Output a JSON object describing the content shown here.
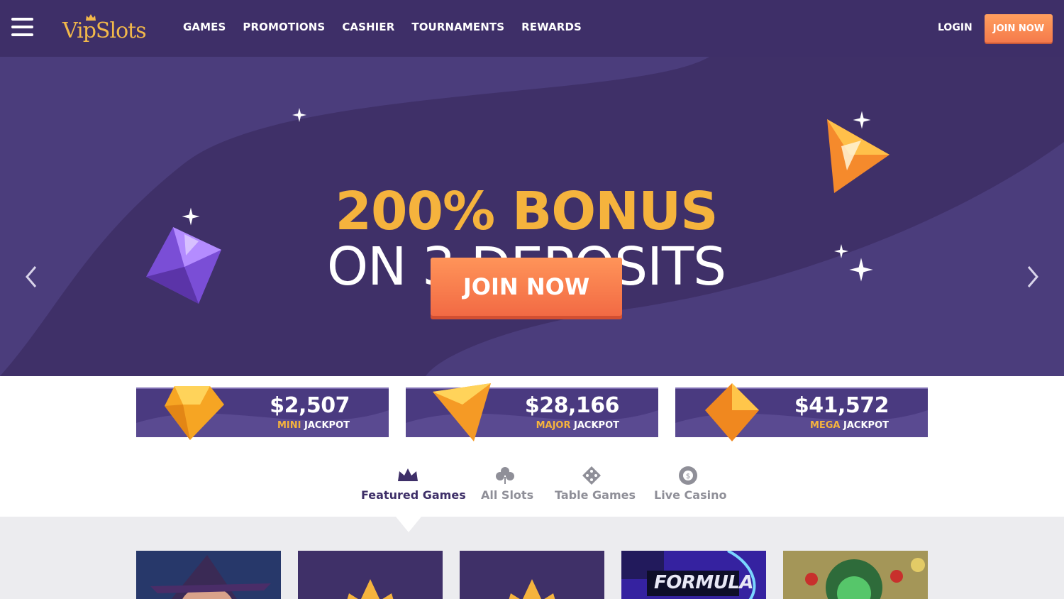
{
  "nav": {
    "brand": "VipSlots",
    "links": [
      "GAMES",
      "PROMOTIONS",
      "CASHIER",
      "TOURNAMENTS",
      "REWARDS"
    ],
    "login": "LOGIN",
    "join": "JOIN NOW",
    "icons": [
      "hamburger-menu-icon",
      "crown-icon"
    ]
  },
  "hero": {
    "title_line1": "200% BONUS",
    "title_line2": "ON 3 DEPOSITS",
    "cta": "JOIN NOW",
    "prev_icon": "chevron-left-icon",
    "next_icon": "chevron-right-icon"
  },
  "jackpots": [
    {
      "amount": "$2,507",
      "tier": "MINI",
      "suffix": "JACKPOT"
    },
    {
      "amount": "$28,166",
      "tier": "MAJOR",
      "suffix": "JACKPOT"
    },
    {
      "amount": "$41,572",
      "tier": "MEGA",
      "suffix": "JACKPOT"
    }
  ],
  "tabs": [
    {
      "label": "Featured Games",
      "icon": "crown-icon",
      "active": true
    },
    {
      "label": "All Slots",
      "icon": "clover-icon",
      "active": false
    },
    {
      "label": "Table Games",
      "icon": "dice-icon",
      "active": false
    },
    {
      "label": "Live Casino",
      "icon": "chip-icon",
      "active": false
    }
  ],
  "games": [
    {
      "name": "witch-slot-thumbnail"
    },
    {
      "name": "placeholder-thumbnail"
    },
    {
      "name": "placeholder-thumbnail"
    },
    {
      "title": "FORMULA"
    },
    {
      "name": "medusa-slot-thumbnail"
    }
  ],
  "colors": {
    "nav_bg": "#3e2f68",
    "hero_bg": "#3f3068",
    "accent_gold": "#f5b33d",
    "accent_orange": "#f57a4b",
    "jackpot_bg": "#5a4a91"
  }
}
